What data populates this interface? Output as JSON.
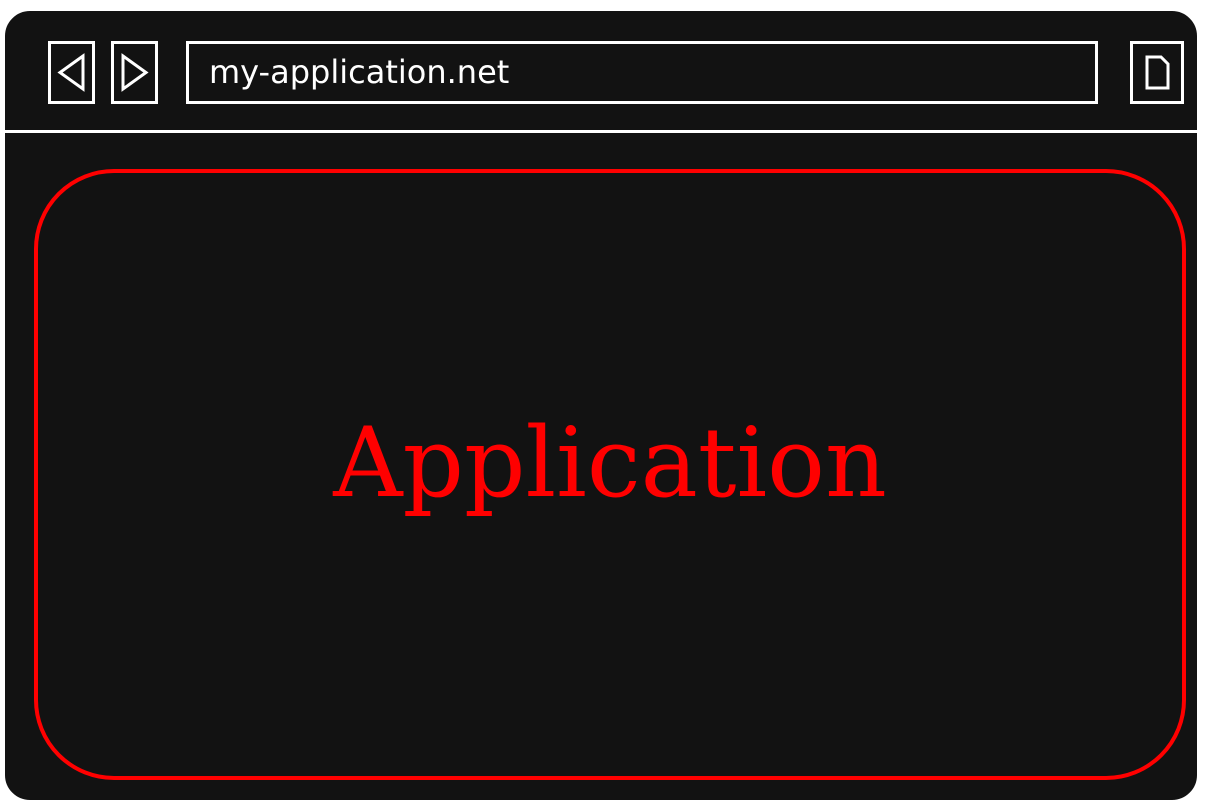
{
  "address_bar": {
    "url": "my-application.net"
  },
  "toolbar": {
    "back_icon": "triangle-left",
    "forward_icon": "triangle-right",
    "page_icon": "document"
  },
  "content": {
    "label": "Application"
  },
  "colors": {
    "background": "#121212",
    "frame": "#ffffff",
    "accent": "#ff0000"
  }
}
